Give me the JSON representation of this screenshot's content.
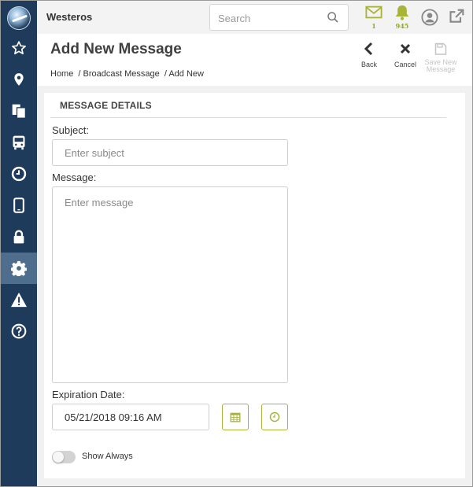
{
  "app": {
    "name": "Westeros"
  },
  "header": {
    "search_placeholder": "Search",
    "mail_count": "1",
    "notification_count": "945",
    "accent_color": "#a9b437"
  },
  "sidebar": {
    "items": [
      {
        "icon": "star-icon"
      },
      {
        "icon": "map-pin-icon"
      },
      {
        "icon": "documents-icon"
      },
      {
        "icon": "bus-icon"
      },
      {
        "icon": "clock-icon"
      },
      {
        "icon": "tablet-icon"
      },
      {
        "icon": "lock-icon"
      },
      {
        "icon": "gear-icon",
        "active": true
      },
      {
        "icon": "warning-icon"
      },
      {
        "icon": "help-icon"
      }
    ]
  },
  "page": {
    "title": "Add New Message",
    "breadcrumb": [
      "Home",
      "/ Broadcast Message",
      "/ Add New"
    ],
    "actions": {
      "back": "Back",
      "cancel": "Cancel",
      "save_line1": "Save New",
      "save_line2": "Message"
    }
  },
  "form": {
    "section_title": "MESSAGE DETAILS",
    "subject_label": "Subject:",
    "subject_placeholder": "Enter subject",
    "message_label": "Message:",
    "message_placeholder": "Enter message",
    "expiration_label": "Expiration Date:",
    "expiration_value": "05/21/2018 09:16 AM",
    "show_always_label": "Show Always",
    "show_always_on": false
  }
}
